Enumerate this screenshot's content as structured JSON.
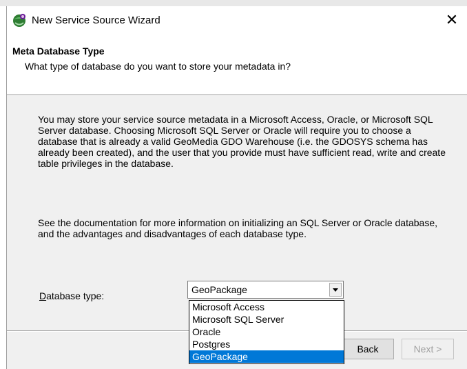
{
  "window": {
    "title": "New Service Source Wizard",
    "close_glyph": "✕",
    "icon": "wizard-app-icon"
  },
  "header": {
    "title": "Meta Database Type",
    "subtitle": "What type of database do you want to store your metadata in?"
  },
  "body": {
    "paragraph1": "You may store your service source metadata in a Microsoft Access, Oracle, or Microsoft SQL Server database. Choosing Microsoft SQL Server or Oracle will require you to choose a database that is already a valid GeoMedia GDO Warehouse (i.e. the GDOSYS schema has already been created), and the user that you provide must have sufficient read, write and create table privileges in the database.",
    "paragraph2": "See the documentation for more information on initializing an SQL Server or Oracle database, and the advantages and disadvantages of each database type."
  },
  "db_type": {
    "label_mnemonic": "D",
    "label_rest": "atabase type:",
    "selected": "GeoPackage",
    "options": [
      "Microsoft Access",
      "Microsoft SQL Server",
      "Oracle",
      "Postgres",
      "GeoPackage"
    ]
  },
  "buttons": {
    "back_visible": "Back",
    "next": "Next >"
  },
  "colors": {
    "selection": "#0078d7",
    "dialog_bg": "#f0f0f0"
  }
}
